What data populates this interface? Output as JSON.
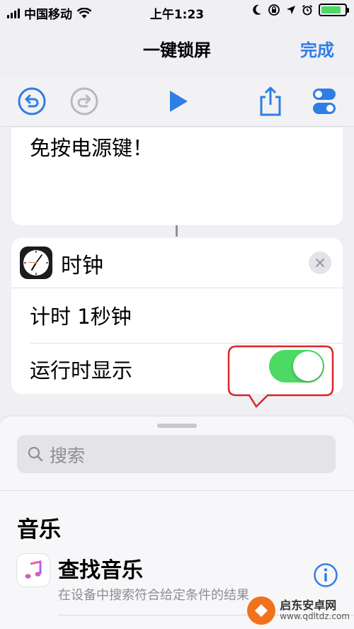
{
  "status_bar": {
    "carrier": "中国移动",
    "time": "上午1:23",
    "battery_level": 0.85,
    "icons": [
      "signal-icon",
      "wifi-icon",
      "moon-icon",
      "orientation-lock-icon",
      "location-icon",
      "alarm-icon",
      "battery-icon"
    ]
  },
  "nav": {
    "title": "一键锁屏",
    "done_label": "完成"
  },
  "toolbar": {
    "icons": [
      "undo-icon",
      "redo-icon",
      "play-icon",
      "share-icon",
      "settings-toggle-icon"
    ],
    "accent": "#2e7ee6",
    "disabled": "#b8b8bd"
  },
  "card_text": {
    "text": "免按电源键！"
  },
  "clock_action": {
    "title": "时钟",
    "timer_label": "计时 1秒钟",
    "show_when_run_label": "运行时显示",
    "show_when_run_on": true,
    "toggle_color": "#4cd964"
  },
  "annotation": {
    "color": "#d9262b"
  },
  "sheet": {
    "search_placeholder": "搜索",
    "section_title": "音乐",
    "item": {
      "title": "查找音乐",
      "subtitle": "在设备中搜索符合给定条件的结果"
    }
  },
  "watermark": {
    "name": "启东安卓网",
    "url": "www.qdltdz.com"
  }
}
